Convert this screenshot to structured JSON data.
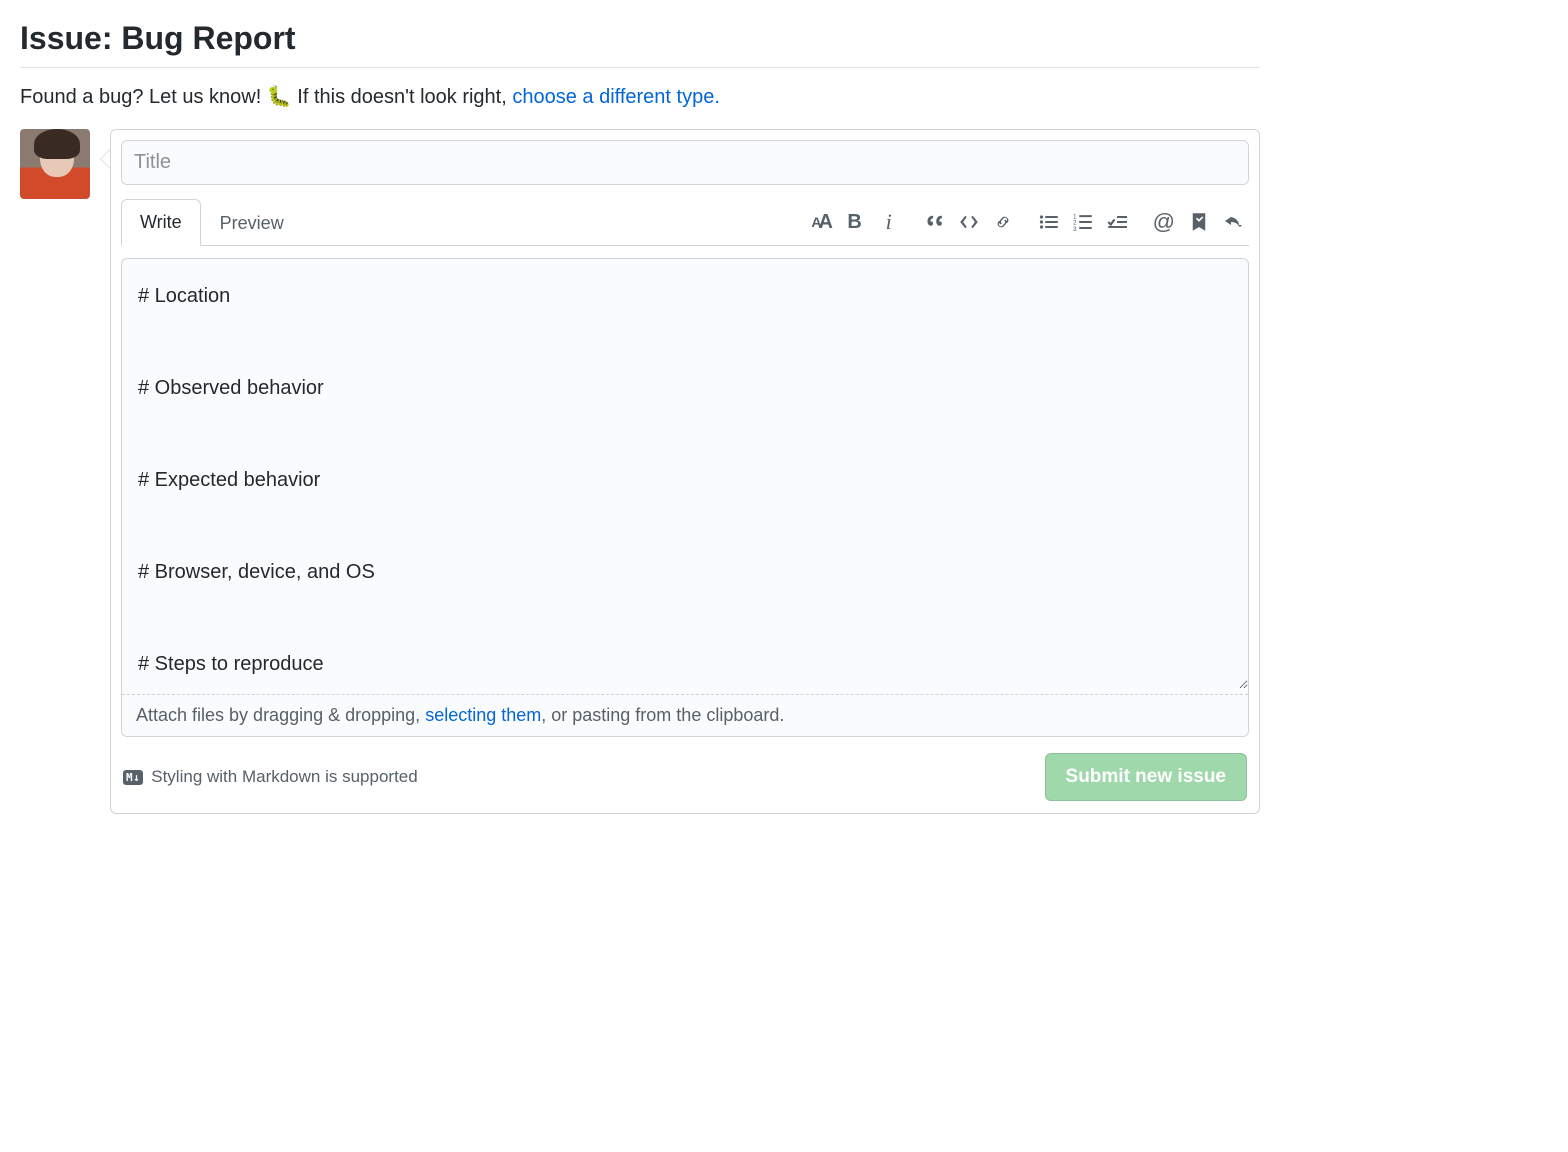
{
  "page": {
    "title": "Issue: Bug Report",
    "intro_prefix": "Found a bug? Let us know! 🐛   If this doesn't look right, ",
    "intro_link": "choose a different type."
  },
  "editor": {
    "title_placeholder": "Title",
    "tabs": {
      "write": "Write",
      "preview": "Preview"
    },
    "body": "# Location\n\n# Observed behavior\n\n# Expected behavior\n\n# Browser, device, and OS\n\n# Steps to reproduce\n\n# Screenshots",
    "attach": {
      "before": "Attach files by dragging & dropping, ",
      "link": "selecting them",
      "after": ", or pasting from the clipboard."
    }
  },
  "footer": {
    "markdown_badge": "M↓",
    "markdown_text": "Styling with Markdown is supported",
    "submit_label": "Submit new issue"
  },
  "toolbar_icons": {
    "heading": "heading-icon",
    "bold": "bold-icon",
    "italic": "italic-icon",
    "quote": "quote-icon",
    "code": "code-icon",
    "link": "link-icon",
    "ul": "unordered-list-icon",
    "ol": "ordered-list-icon",
    "task": "task-list-icon",
    "mention": "mention-icon",
    "bookmark": "bookmark-icon",
    "reply": "reply-icon"
  }
}
